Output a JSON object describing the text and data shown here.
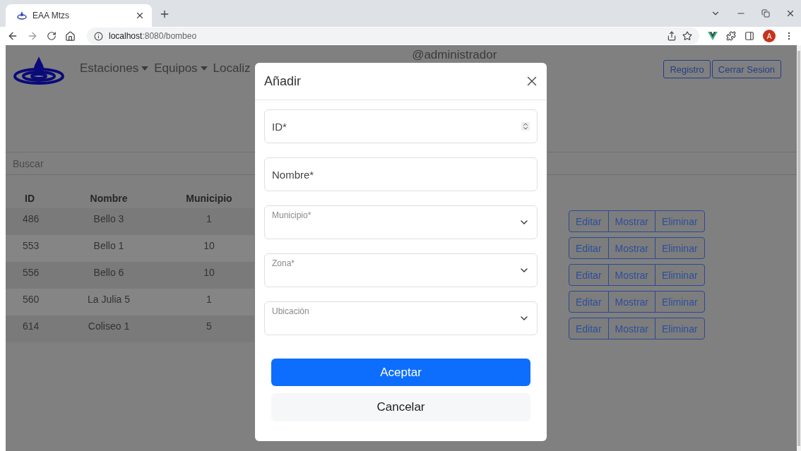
{
  "browser": {
    "tab": {
      "title": "EAA Mtzs"
    },
    "url": {
      "host": "localhost",
      "path": ":8080/bombeo"
    },
    "profile_initial": "A"
  },
  "navbar": {
    "menus": [
      {
        "label": "Estaciones",
        "dropdown": true
      },
      {
        "label": "Equipos",
        "dropdown": true
      },
      {
        "label": "Localiz",
        "dropdown": false
      }
    ],
    "user": "@administrador",
    "buttons": [
      "Registro",
      "Cerrar Sesion"
    ]
  },
  "search": {
    "placeholder": "Buscar"
  },
  "table": {
    "columns": [
      "ID",
      "Nombre",
      "Municipio"
    ],
    "rows": [
      {
        "cells": [
          "486",
          "Bello 3",
          "1"
        ],
        "actions": [
          "Editar",
          "Mostrar",
          "Eliminar"
        ]
      },
      {
        "cells": [
          "553",
          "Bello 1",
          "10"
        ],
        "actions": [
          "Editar",
          "Mostrar",
          "Eliminar"
        ]
      },
      {
        "cells": [
          "556",
          "Bello 6",
          "10"
        ],
        "actions": [
          "Editar",
          "Mostrar",
          "Eliminar"
        ]
      },
      {
        "cells": [
          "560",
          "La Julia 5",
          "1"
        ],
        "actions": [
          "Editar",
          "Mostrar",
          "Eliminar"
        ]
      },
      {
        "cells": [
          "614",
          "Coliseo 1",
          "5"
        ],
        "actions": [
          "Editar",
          "Mostrar",
          "Eliminar"
        ]
      }
    ]
  },
  "modal": {
    "title": "Añadir",
    "fields": [
      {
        "kind": "number",
        "placeholder": "ID*"
      },
      {
        "kind": "text",
        "placeholder": "Nombre*"
      },
      {
        "kind": "select",
        "label": "Municipio*"
      },
      {
        "kind": "select",
        "label": "Zona*"
      },
      {
        "kind": "select",
        "label": "Ubicación"
      }
    ],
    "buttons": [
      {
        "label": "Aceptar",
        "kind": "primary"
      },
      {
        "label": "Cancelar",
        "kind": "secondary"
      }
    ]
  }
}
